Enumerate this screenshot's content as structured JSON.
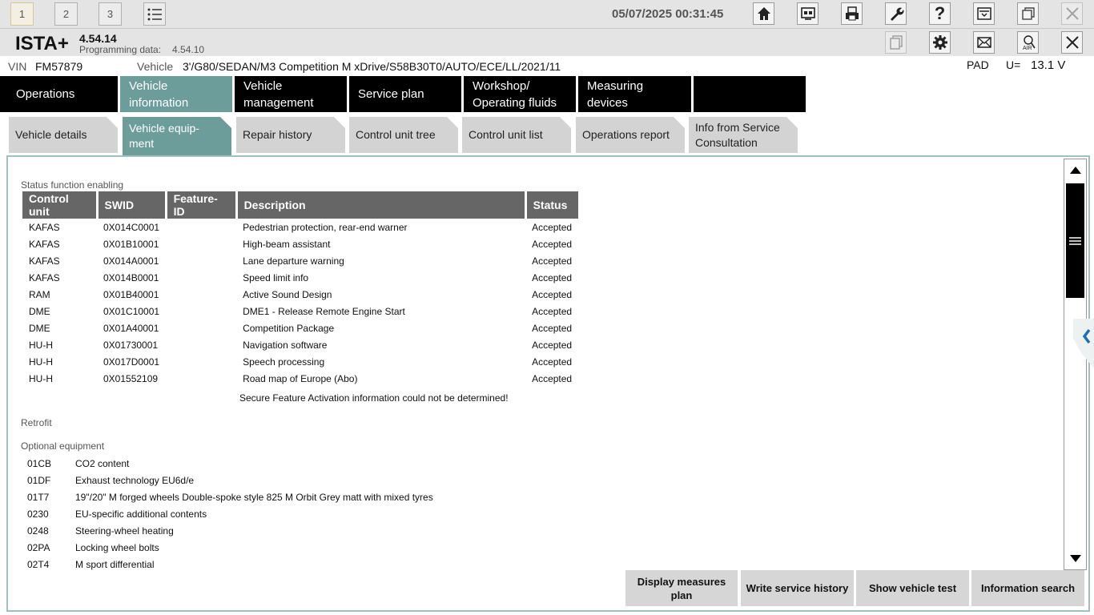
{
  "workspaces": [
    "1",
    "2",
    "3"
  ],
  "datetime": "05/07/2025 00:31:45",
  "app": {
    "name": "ISTA+",
    "version": "4.54.14",
    "prog_label": "Programming data:",
    "prog_version": "4.54.10"
  },
  "vehicle": {
    "vin_label": "VIN",
    "vin": "FM57879",
    "vehicle_label": "Vehicle",
    "vehicle": "3'/G80/SEDAN/M3 Competition M xDrive/S58B30T0/AUTO/ECE/LL/2021/11",
    "pad": "PAD",
    "u_label": "U=",
    "voltage": "13.1 V"
  },
  "main_tabs": [
    "Operations",
    "Vehicle information",
    "Vehicle management",
    "Service plan",
    "Workshop/ Operating fluids",
    "Measuring devices"
  ],
  "sub_tabs": [
    "Vehicle details",
    "Vehicle equip- ment",
    "Repair history",
    "Control unit tree",
    "Control unit list",
    "Operations report",
    "Info from Service Consultation"
  ],
  "status_title": "Status function enabling",
  "columns": [
    "Control unit",
    "SWID",
    "Feature-ID",
    "Description",
    "Status"
  ],
  "rows": [
    [
      "KAFAS",
      "0X014C0001",
      "",
      "Pedestrian protection, rear-end warner",
      "Accepted"
    ],
    [
      "KAFAS",
      "0X01B10001",
      "",
      "High-beam assistant",
      "Accepted"
    ],
    [
      "KAFAS",
      "0X014A0001",
      "",
      "Lane departure warning",
      "Accepted"
    ],
    [
      "KAFAS",
      "0X014B0001",
      "",
      "Speed limit info",
      "Accepted"
    ],
    [
      "RAM",
      "0X01B40001",
      "",
      "Active Sound Design",
      "Accepted"
    ],
    [
      "DME",
      "0X01C10001",
      "",
      "DME1 - Release Remote Engine Start",
      "Accepted"
    ],
    [
      "DME",
      "0X01A40001",
      "",
      "Competition Package",
      "Accepted"
    ],
    [
      "HU-H",
      "0X01730001",
      "",
      "Navigation software",
      "Accepted"
    ],
    [
      "HU-H",
      "0X017D0001",
      "",
      "Speech processing",
      "Accepted"
    ],
    [
      "HU-H",
      "0X01552109",
      "",
      "Road map of Europe (Abo)",
      "Accepted"
    ]
  ],
  "sfa_message": "Secure Feature Activation information could not be determined!",
  "retrofit_title": "Retrofit",
  "optional_title": "Optional equipment",
  "optional": [
    [
      "01CB",
      "CO2 content"
    ],
    [
      "01DF",
      "Exhaust technology EU6d/e"
    ],
    [
      "01T7",
      "19\"/20\" M forged wheels Double-spoke style 825 M Orbit Grey matt with mixed tyres"
    ],
    [
      "0230",
      "EU-specific additional contents"
    ],
    [
      "0248",
      "Steering-wheel heating"
    ],
    [
      "02PA",
      "Locking wheel bolts"
    ],
    [
      "02T4",
      "M sport differential"
    ]
  ],
  "buttons": [
    "Display measures plan",
    "Write service history",
    "Show vehicle test",
    "Information search"
  ],
  "icons": [
    "home-icon",
    "connect-icon",
    "print-icon",
    "wrench-icon",
    "help-icon",
    "minimize-icon",
    "restore-icon",
    "close-icon",
    "documents-icon",
    "settings-icon",
    "mail-icon",
    "air-icon"
  ],
  "help_glyph": "?"
}
